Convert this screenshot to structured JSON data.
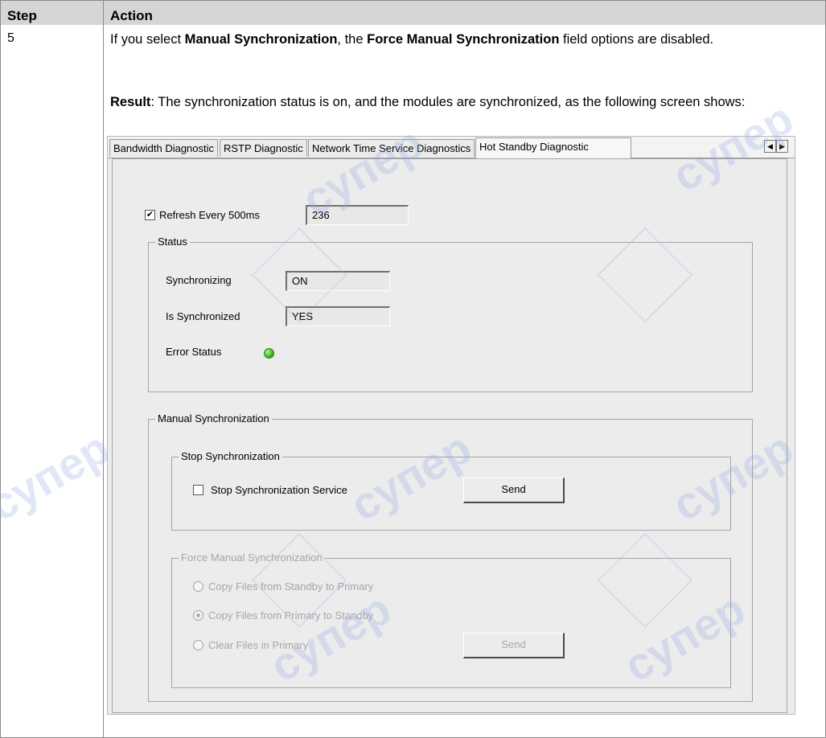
{
  "table": {
    "header_step": "Step",
    "header_action": "Action",
    "step_number": "5"
  },
  "action": {
    "line1_pre": "If you select ",
    "line1_bold1": "Manual Synchronization",
    "line1_mid": ", the ",
    "line1_bold2": "Force Manual Synchronization",
    "line1_post": " field options are disabled.",
    "result_label": "Result",
    "result_text": ": The synchronization status is on, and the modules are synchronized, as the following screen shows:"
  },
  "screen": {
    "tabs": [
      {
        "label": "Bandwidth Diagnostic"
      },
      {
        "label": "RSTP Diagnostic"
      },
      {
        "label": "Network Time Service Diagnostics"
      },
      {
        "label": "Hot Standby Diagnostic"
      }
    ],
    "active_tab": "Hot Standby Diagnostic",
    "scroll_left": "◀",
    "scroll_right": "▶",
    "refresh_label": "Refresh Every 500ms",
    "refresh_checked": true,
    "refresh_value": "236",
    "status": {
      "legend": "Status",
      "synchronizing_label": "Synchronizing",
      "synchronizing_value": "ON",
      "is_synchronized_label": "Is Synchronized",
      "is_synchronized_value": "YES",
      "error_status_label": "Error Status",
      "error_led_color": "#35b31b"
    },
    "manual": {
      "legend": "Manual Synchronization",
      "stop_group": {
        "legend": "Stop Synchronization",
        "checkbox_label": "Stop Synchronization Service",
        "checked": false,
        "send_label": "Send"
      },
      "force_group": {
        "legend": "Force Manual Synchronization",
        "options": [
          {
            "label": "Copy Files from Standby to Primary",
            "selected": false
          },
          {
            "label": "Copy Files from Primary to Standby",
            "selected": true
          },
          {
            "label": "Clear Files in Primary",
            "selected": false
          }
        ],
        "send_label": "Send"
      }
    }
  },
  "watermark_text": "супер"
}
